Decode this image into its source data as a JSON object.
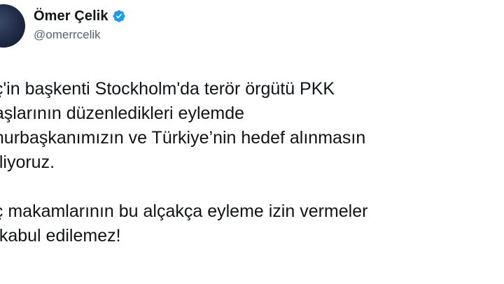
{
  "author": {
    "name": "Ömer Çelik",
    "handle": "@omerrcelik",
    "verified_icon": "verified-badge-icon",
    "verified_color": "#1d9bf0"
  },
  "tweet": {
    "lines": [
      "eç'in başkenti Stockholm'da terör örgütü PKK",
      "daşlarının düzenledikleri eylemde",
      "nhurbaşkanımızın ve Türkiye’nin hedef alınmasın",
      "etliyoruz.",
      "",
      "eç makamlarının bu alçakça eyleme izin vermeler",
      "a kabul edilemez!"
    ]
  }
}
